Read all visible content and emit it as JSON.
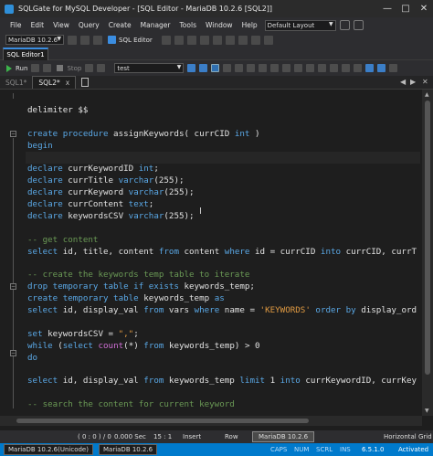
{
  "window": {
    "title": "SQLGate for MySQL Developer - [SQL Editor - MariaDB 10.2.6 [SQL2]]",
    "min_label": "—",
    "max_label": "□",
    "close_label": "✕"
  },
  "menu": {
    "items": [
      "File",
      "Edit",
      "View",
      "Query",
      "Create",
      "Manager",
      "Tools",
      "Window",
      "Help"
    ],
    "layout_select": "Default Layout"
  },
  "toolbar1": {
    "connection_select": "MariaDB 10.2.6",
    "sql_editor_label": "SQL Editor"
  },
  "doc_tab": {
    "label": "SQL Editor1"
  },
  "toolbar2": {
    "run_label": "Run",
    "stop_label": "Stop",
    "database_select": "test"
  },
  "sql_tabs": {
    "tab1": "SQL1*",
    "tab2": "SQL2*",
    "close": "x"
  },
  "code_lines": [
    "delimiter $$",
    "",
    "create procedure assignKeywords( currCID int )",
    "begin",
    "",
    "declare currKeywordID int;",
    "declare currTitle varchar(255);",
    "declare currKeyword varchar(255);",
    "declare currContent text;",
    "declare keywordsCSV varchar(255);",
    "",
    "-- get content",
    "select id, title, content from content where id = currCID into currCID, currT",
    "",
    "-- create the keywords temp table to iterate",
    "drop temporary table if exists keywords_temp;",
    "create temporary table keywords_temp as",
    "select id, display_val from vars where name = 'KEYWORDS' order by display_ord",
    "",
    "set keywordsCSV = \",\";",
    "while (select count(*) from keywords_temp) > 0",
    "do",
    "",
    "select id, display_val from keywords_temp limit 1 into currKeywordID, currKey",
    "",
    "-- search the content for current keyword"
  ],
  "status": {
    "position": "( 0 : 0 ) / 0",
    "elapsed": "0.000 Sec",
    "count": "15 : 1",
    "mode": "Insert",
    "row": "Row",
    "db_badge": "MariaDB 10.2.6",
    "grid": "Horizontal Grid"
  },
  "bottom": {
    "connection": "MariaDB 10.2.6(Unicode)",
    "version_badge": "MariaDB 10.2.6",
    "caps": "CAPS",
    "num": "NUM",
    "scrl": "SCRL",
    "ins": "INS",
    "app_version": "6.5.1.0",
    "activated": "Activated"
  },
  "colors": {
    "keyword": "#5aa8e6",
    "function": "#d06fd6",
    "string": "#e09a42",
    "comment": "#6a9955",
    "accent": "#007acc"
  }
}
